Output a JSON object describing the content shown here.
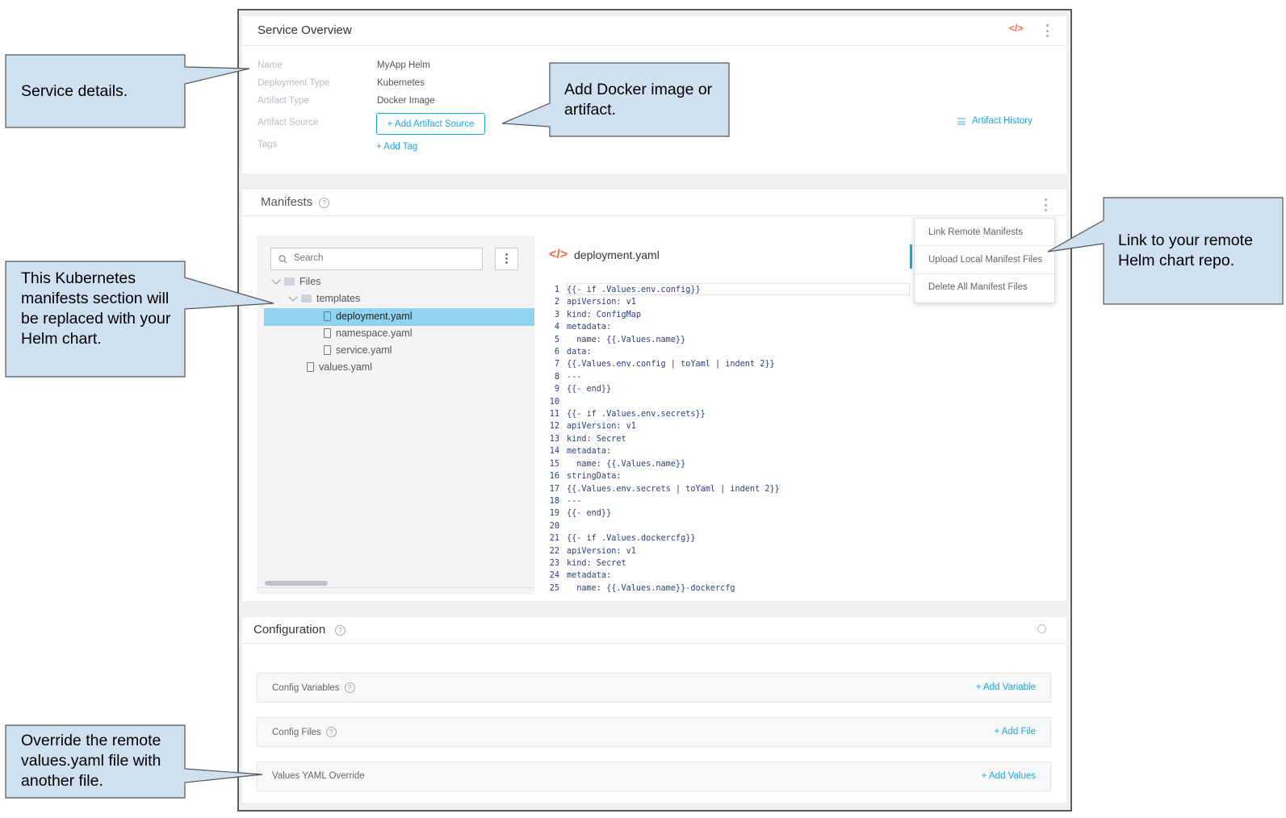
{
  "callouts": {
    "service_details": "Service details.",
    "add_docker": "Add Docker image or artifact.",
    "manifests": "This Kubernetes manifests section will be replaced with your Helm chart.",
    "link_remote": "Link to your remote Helm chart repo.",
    "override": "Override the remote values.yaml file with another file."
  },
  "service_overview": {
    "title": "Service Overview",
    "fields": [
      {
        "label": "Name",
        "value": "MyApp Helm"
      },
      {
        "label": "Deployment Type",
        "value": "Kubernetes"
      },
      {
        "label": "Artifact Type",
        "value": "Docker Image"
      },
      {
        "label": "Artifact Source",
        "value": "+ Add Artifact Source"
      },
      {
        "label": "Tags",
        "value": "+ Add Tag"
      }
    ],
    "artifact_history": "Artifact History"
  },
  "manifests": {
    "title": "Manifests",
    "search_placeholder": "Search",
    "tree": {
      "root": "Files",
      "folder": "templates",
      "files": [
        "deployment.yaml",
        "namespace.yaml",
        "service.yaml"
      ],
      "root_file": "values.yaml"
    },
    "open_file": "deployment.yaml",
    "menu": [
      "Link Remote Manifests",
      "Upload Local Manifest Files",
      "Delete All Manifest Files"
    ],
    "code": [
      "{{- if .Values.env.config}}",
      "apiVersion: v1",
      "kind: ConfigMap",
      "metadata:",
      "  name: {{.Values.name}}",
      "data:",
      "{{.Values.env.config | toYaml | indent 2}}",
      "---",
      "{{- end}}",
      "",
      "{{- if .Values.env.secrets}}",
      "apiVersion: v1",
      "kind: Secret",
      "metadata:",
      "  name: {{.Values.name}}",
      "stringData:",
      "{{.Values.env.secrets | toYaml | indent 2}}",
      "---",
      "{{- end}}",
      "",
      "{{- if .Values.dockercfg}}",
      "apiVersion: v1",
      "kind: Secret",
      "metadata:",
      "  name: {{.Values.name}}-dockercfg"
    ]
  },
  "configuration": {
    "title": "Configuration",
    "rows": [
      {
        "label": "Config Variables",
        "action": "+ Add Variable"
      },
      {
        "label": "Config Files",
        "action": "+ Add File"
      },
      {
        "label": "Values YAML Override",
        "action": "+ Add Values"
      }
    ]
  },
  "colors": {
    "accent": "#1ba5de",
    "callout_fill": "#cfe0f0",
    "selected_row": "#8fd3f1",
    "logo": "#f26b3a"
  }
}
